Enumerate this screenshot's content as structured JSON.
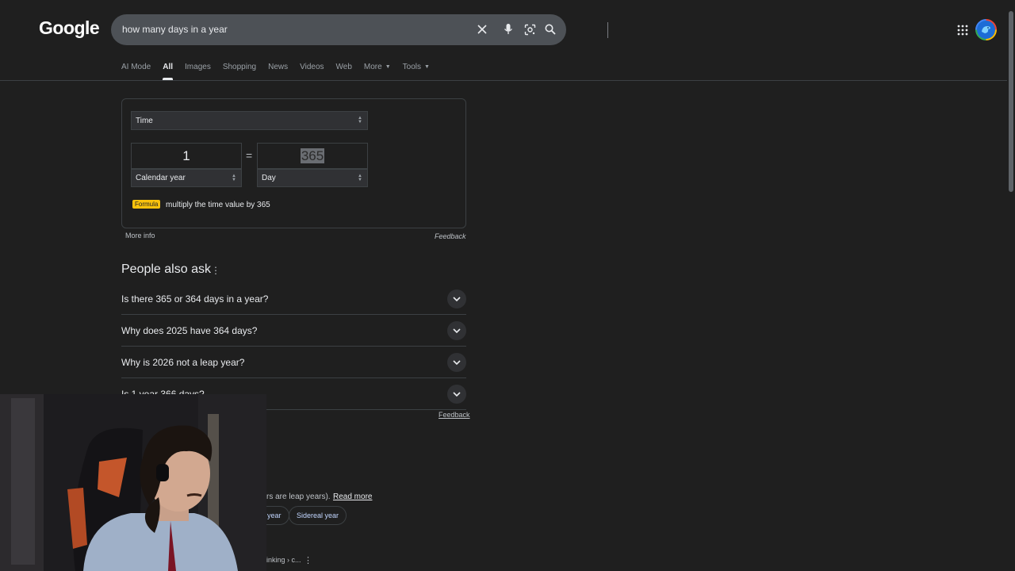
{
  "header": {
    "logo": "Google",
    "search": {
      "value": "how many days in a year"
    }
  },
  "tabs": [
    {
      "label": "AI Mode"
    },
    {
      "label": "All"
    },
    {
      "label": "Images"
    },
    {
      "label": "Shopping"
    },
    {
      "label": "News"
    },
    {
      "label": "Videos"
    },
    {
      "label": "Web"
    },
    {
      "label": "More"
    },
    {
      "label": "Tools"
    }
  ],
  "converter": {
    "category": "Time",
    "from_value": "1",
    "to_value": "365",
    "from_unit": "Calendar year",
    "to_unit": "Day",
    "equals": "=",
    "formula_tag": "Formula",
    "formula_text": "multiply the time value by 365",
    "more_info": "More info",
    "feedback": "Feedback"
  },
  "paa": {
    "title": "People also ask",
    "questions": [
      "Is there 365 or 364 days in a year?",
      "Why does 2025 have 364 days?",
      "Why is 2026 not a leap year?",
      "Is 1 year 366 days?"
    ],
    "feedback": "Feedback"
  },
  "result": {
    "snippet_visible": "rs are leap years).",
    "read_more": "Read more",
    "chips": [
      "year",
      "Sidereal year"
    ],
    "breadcrumb": "inking › c..."
  },
  "colors": {
    "background": "#1f1f1f",
    "search_bg": "#4d5156",
    "formula_tag": "#f9c20c"
  }
}
